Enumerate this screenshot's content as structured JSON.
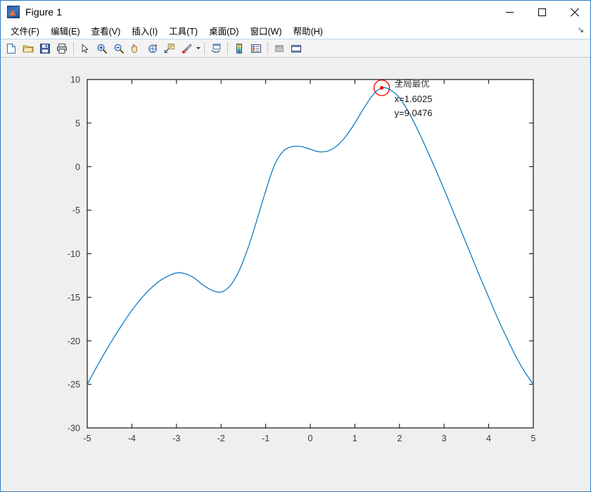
{
  "window": {
    "title": "Figure 1",
    "app_icon": "matlab-figure-icon",
    "controls": {
      "minimize": "—",
      "maximize": "□",
      "close": "✕"
    }
  },
  "menubar": {
    "items": [
      {
        "label": "文件(F)",
        "name": "menu-file"
      },
      {
        "label": "编辑(E)",
        "name": "menu-edit"
      },
      {
        "label": "查看(V)",
        "name": "menu-view"
      },
      {
        "label": "插入(I)",
        "name": "menu-insert"
      },
      {
        "label": "工具(T)",
        "name": "menu-tools"
      },
      {
        "label": "桌面(D)",
        "name": "menu-desktop"
      },
      {
        "label": "窗口(W)",
        "name": "menu-window"
      },
      {
        "label": "帮助(H)",
        "name": "menu-help"
      }
    ],
    "overflow_glyph": "↘"
  },
  "toolbar": {
    "buttons": [
      {
        "name": "new-figure-icon",
        "tooltip": "New Figure"
      },
      {
        "name": "open-file-icon",
        "tooltip": "Open File"
      },
      {
        "name": "save-figure-icon",
        "tooltip": "Save Figure"
      },
      {
        "name": "print-figure-icon",
        "tooltip": "Print Figure"
      },
      {
        "name": "edit-plot-arrow-icon",
        "tooltip": "Edit Plot"
      },
      {
        "name": "zoom-in-icon",
        "tooltip": "Zoom In"
      },
      {
        "name": "zoom-out-icon",
        "tooltip": "Zoom Out"
      },
      {
        "name": "pan-hand-icon",
        "tooltip": "Pan"
      },
      {
        "name": "rotate-3d-icon",
        "tooltip": "Rotate 3D"
      },
      {
        "name": "data-cursor-icon",
        "tooltip": "Data Cursor"
      },
      {
        "name": "brush-select-icon",
        "tooltip": "Brush/Select Data"
      },
      {
        "name": "link-plot-icon",
        "tooltip": "Link Plot"
      },
      {
        "name": "colorbar-icon",
        "tooltip": "Insert Colorbar"
      },
      {
        "name": "legend-icon",
        "tooltip": "Insert Legend"
      },
      {
        "name": "hide-plot-tools-icon",
        "tooltip": "Hide Plot Tools"
      },
      {
        "name": "show-plot-tools-icon",
        "tooltip": "Show Plot Tools"
      }
    ]
  },
  "chart_data": {
    "type": "line",
    "title": "",
    "xlabel": "",
    "ylabel": "",
    "xlim": [
      -5,
      5
    ],
    "ylim": [
      -30,
      10
    ],
    "xticks": [
      "-5",
      "-4",
      "-3",
      "-2",
      "-1",
      "0",
      "1",
      "2",
      "3",
      "4",
      "5"
    ],
    "yticks": [
      "10",
      "5",
      "0",
      "-5",
      "-10",
      "-15",
      "-20",
      "-25",
      "-30"
    ],
    "grid": false,
    "legend": null,
    "line_color": "#0072BD",
    "series": [
      {
        "name": "objective-function",
        "x": [
          -5.0,
          -4.8,
          -4.6,
          -4.4,
          -4.2,
          -4.0,
          -3.8,
          -3.6,
          -3.4,
          -3.2,
          -3.0,
          -2.8,
          -2.6,
          -2.4,
          -2.2,
          -2.0,
          -1.8,
          -1.6,
          -1.4,
          -1.2,
          -1.0,
          -0.8,
          -0.6,
          -0.4,
          -0.2,
          0.0,
          0.2,
          0.4,
          0.6,
          0.8,
          1.0,
          1.2,
          1.4,
          1.6025,
          1.8,
          2.0,
          2.2,
          2.4,
          2.6,
          2.8,
          3.0,
          3.2,
          3.4,
          3.6,
          3.8,
          4.0,
          4.2,
          4.4,
          4.6,
          4.8,
          5.0
        ],
        "y": [
          -25.0,
          -23.1,
          -21.3,
          -19.6,
          -18.0,
          -16.5,
          -15.2,
          -14.1,
          -13.2,
          -12.6,
          -12.2,
          -12.3,
          -12.8,
          -13.6,
          -14.2,
          -14.4,
          -13.7,
          -12.0,
          -9.4,
          -6.2,
          -2.8,
          0.2,
          1.8,
          2.3,
          2.3,
          2.0,
          1.7,
          1.8,
          2.4,
          3.5,
          5.0,
          6.7,
          8.2,
          9.0476,
          8.8,
          7.9,
          6.3,
          4.3,
          2.1,
          -0.2,
          -2.6,
          -5.1,
          -7.6,
          -10.1,
          -12.6,
          -15.0,
          -17.4,
          -19.6,
          -21.7,
          -23.5,
          -25.0
        ]
      }
    ],
    "annotation": {
      "name": "global-optimum-marker",
      "label": "全局最优",
      "x_text": "x=1.6025",
      "y_text": "y=9.0476",
      "x_value": 1.6025,
      "y_value": 9.0476,
      "marker_color": "#ff0000",
      "marker_shape": "circle-with-dot"
    },
    "background": "#ffffff",
    "figure_background": "#efefef"
  }
}
